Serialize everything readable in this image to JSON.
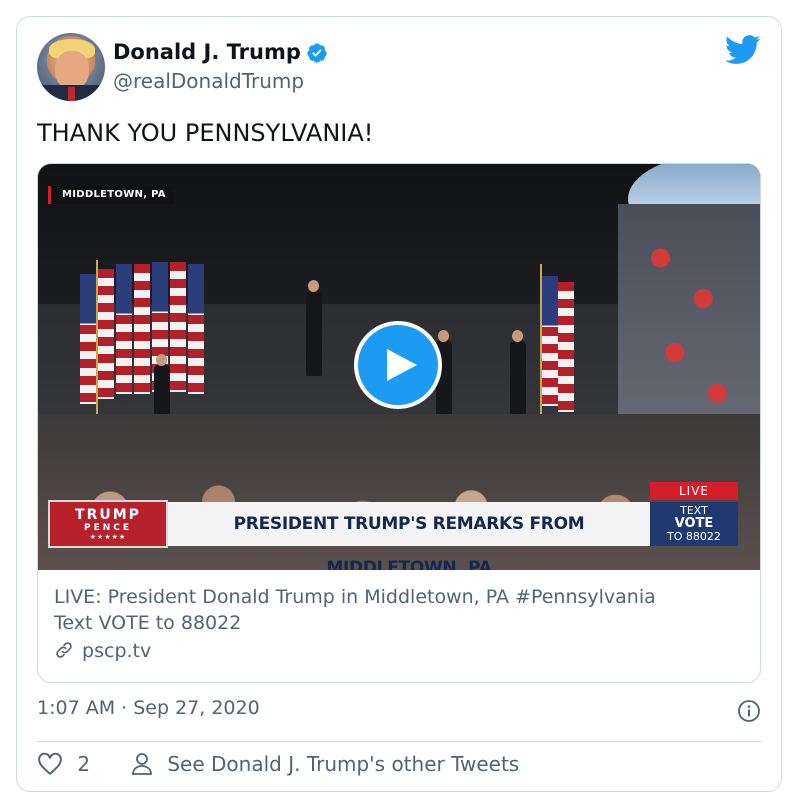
{
  "author": {
    "name": "Donald J. Trump",
    "handle": "@realDonaldTrump",
    "verified": true
  },
  "tweet": {
    "text": "THANK YOU PENNSYLVANIA!"
  },
  "media": {
    "video_location_tag": "MIDDLETOWN, PA",
    "banner_logo_line1": "TRUMP",
    "banner_logo_line2": "PENCE",
    "banner_logo_stars": "★★★★★",
    "banner_headline": "PRESIDENT TRUMP'S REMARKS FROM MIDDLETOWN, PA",
    "live_badge": "LIVE",
    "text_vote_line1": "TEXT",
    "text_vote_line2": "VOTE",
    "text_vote_line3": "TO 88022",
    "caption_line1": "LIVE: President Donald Trump in Middletown, PA #Pennsylvania",
    "caption_line2": "Text VOTE to 88022",
    "link": "pscp.tv"
  },
  "meta": {
    "timestamp": "1:07 AM · Sep 27, 2020"
  },
  "actions": {
    "like_count": "2",
    "other_tweets_label": "See Donald J. Trump's other Tweets"
  },
  "colors": {
    "accent": "#1d9bf0",
    "secondary_text": "#536471",
    "border": "#cfd9de"
  },
  "icons": [
    "verified-badge-icon",
    "twitter-bird-icon",
    "play-icon",
    "link-icon",
    "info-icon",
    "heart-icon",
    "person-icon"
  ]
}
